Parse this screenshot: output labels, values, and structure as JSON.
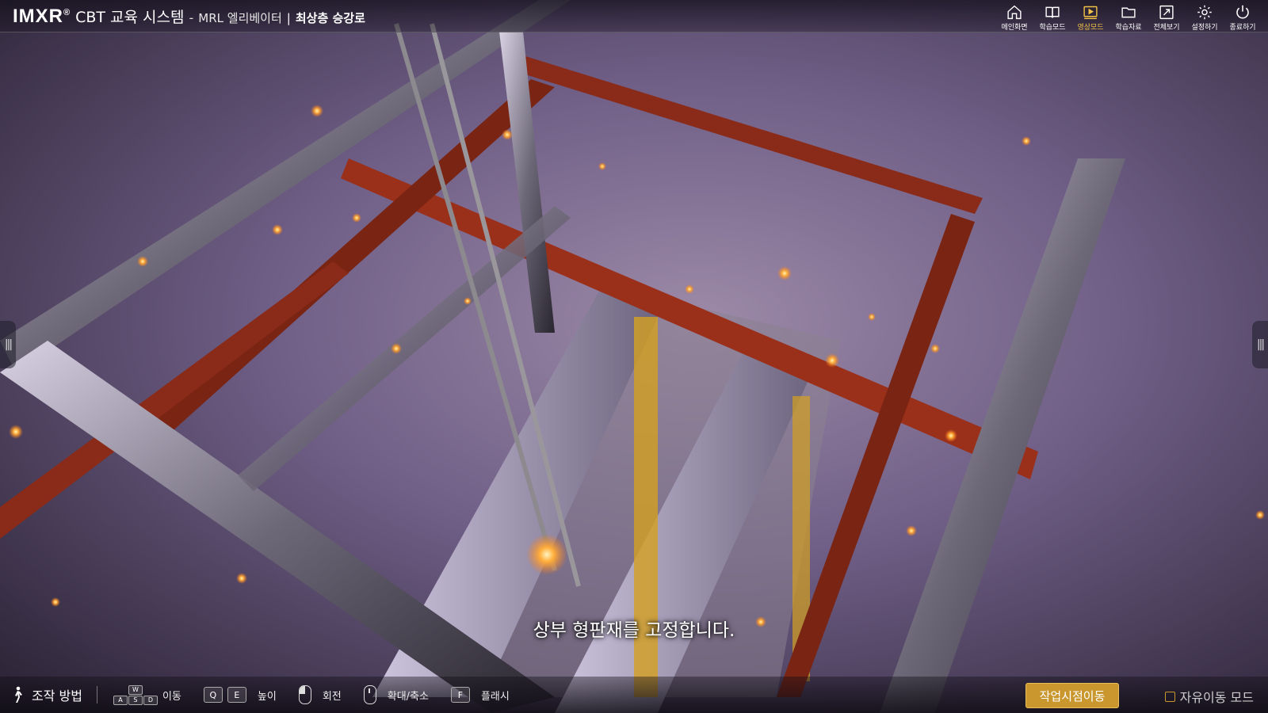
{
  "header": {
    "logo": "IMXR",
    "logo_mark": "®",
    "app_name": "CBT 교육 시스템",
    "separator": "-",
    "subtitle": "MRL 엘리베이터",
    "divider": "|",
    "stage": "최상층 승강로"
  },
  "menu": [
    {
      "label": "메인화면",
      "icon": "home-icon"
    },
    {
      "label": "학습모드",
      "icon": "book-icon"
    },
    {
      "label": "영상모드",
      "icon": "video-icon",
      "active": true
    },
    {
      "label": "학습자료",
      "icon": "folder-icon"
    },
    {
      "label": "전체보기",
      "icon": "fullscreen-icon"
    },
    {
      "label": "설정하기",
      "icon": "gear-icon"
    },
    {
      "label": "종료하기",
      "icon": "power-icon"
    }
  ],
  "caption": "상부 형판재를 고정합니다.",
  "controls": {
    "title": "조작 방법",
    "move": {
      "keys": [
        "W",
        "A",
        "S",
        "D"
      ],
      "label": "이동"
    },
    "height": {
      "keys": [
        "Q",
        "E"
      ],
      "label": "높이"
    },
    "rotate": {
      "label": "회전"
    },
    "zoom": {
      "label": "확대/축소"
    },
    "flash": {
      "key": "F",
      "label": "플래시"
    }
  },
  "actions": {
    "work_view": "작업시점이동",
    "free_mode": "자유이동 모드"
  },
  "colors": {
    "accent": "#c9972e",
    "active_menu": "#f2c246"
  }
}
